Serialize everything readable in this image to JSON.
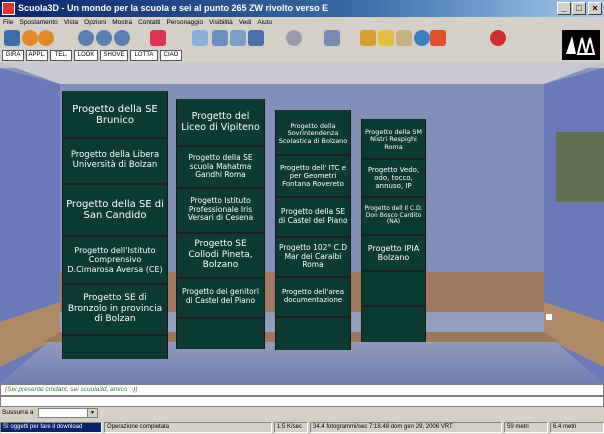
{
  "window": {
    "title": "Scuola3D - Un mondo per la scuola e sei al punto 265 ZW rivolto verso E",
    "minimize": "_",
    "maximize": "□",
    "close": "×"
  },
  "menu": [
    "File",
    "Spostamento",
    "Vista",
    "Opzioni",
    "Mostra",
    "Contatti",
    "Personaggio",
    "Visibilità",
    "Vedi",
    "Aiuto"
  ],
  "commands": [
    "GIRA",
    "APPL.",
    "TEL.",
    "LOOK",
    "SHOVE",
    "LOTTA",
    "CIAO"
  ],
  "panels": [
    {
      "cells": [
        "Progetto della SE Brunico",
        "Progetto della Libera Università di Bolzan",
        "Progetto della SE di San Candido",
        "Progetto dell'Istituto Comprensivo D.Cimarosa Aversa (CE)",
        "Progetto SE di Bronzolo in provincia di Bolzan",
        ""
      ]
    },
    {
      "cells": [
        "Progetto del Liceo di Vipiteno",
        "Progetto della SE scuola Mahatma Gandhi Roma",
        "Progetto Istituto Professionale Iris Versari di Cesena",
        "Progetto SE Collodi Pineta, Bolzano",
        "Progetto dei genitori di Castel del Piano",
        ""
      ]
    },
    {
      "cells": [
        "Progetto della Sovrintendenza Scolastica di Bolzano",
        "Progetto dell' ITC e per Geometri Fontana Rovereto",
        "Progetto della SE di Castel del Piano",
        "Progetto 102° C.D Mar dei Caraibi Roma",
        "Progetto dell'area documentazione",
        ""
      ]
    },
    {
      "cells": [
        "Progetto della SM Nistri Respighi Roma",
        "Progetto Vedo, odo, tocco, annuso, IP",
        "Progetto dell Il C.D. Don Bosco Cardito (NA)",
        "Progetto IPIA Bolzano",
        "",
        ""
      ]
    }
  ],
  "chat": {
    "message": "(Sei presente cmdant, sei scuola3d, amico :-))"
  },
  "combo": {
    "label": "Sussurra a"
  },
  "status": {
    "left": "Sì oggetti per fare il download",
    "progress": "Operazione completata",
    "speed": "1.5 K/sec",
    "fps": "34.4 fotogrammi/sec  7:18.48 dom gen 29, 2006 VRT",
    "mem1": "59 metri",
    "mem2": "6.4 metri"
  },
  "colors": {
    "title_gradient_start": "#0a246a",
    "panel_bg": "#0b3b32",
    "chat_text": "#3a7a3a"
  }
}
